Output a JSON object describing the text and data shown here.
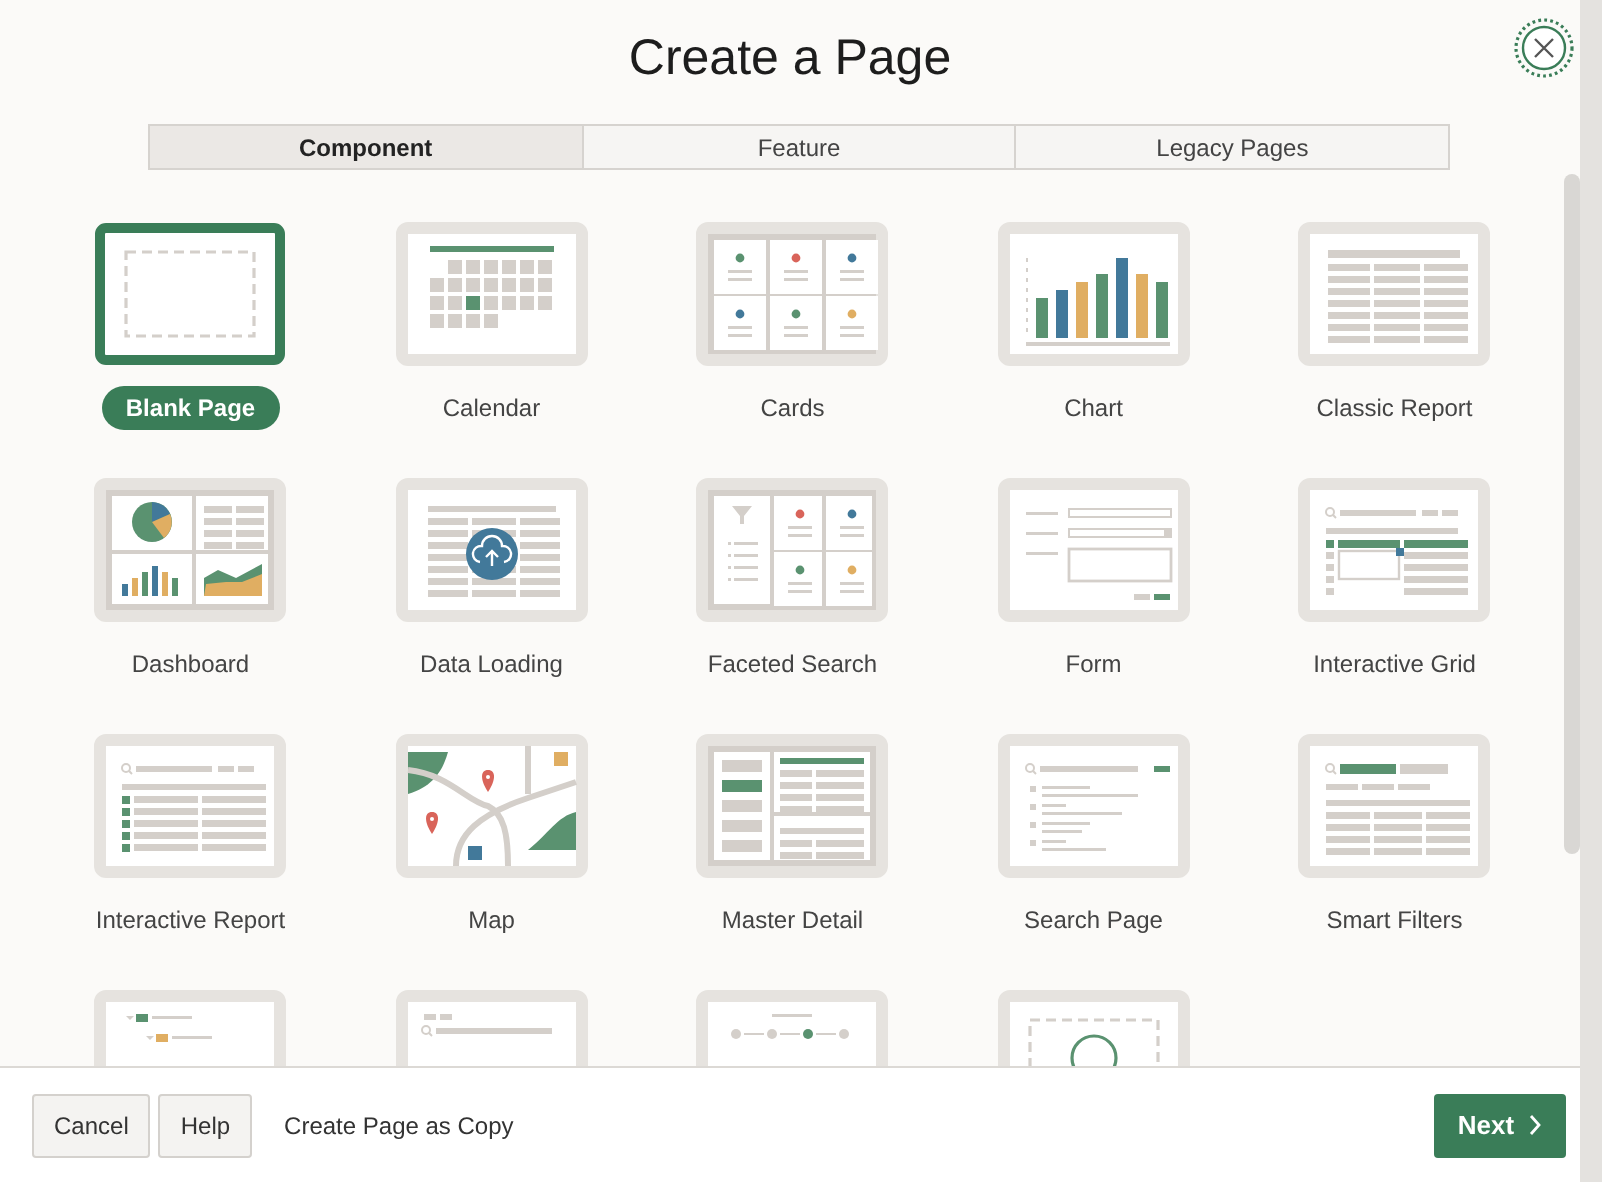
{
  "dialog": {
    "title": "Create a Page"
  },
  "tabs": [
    {
      "label": "Component",
      "selected": true
    },
    {
      "label": "Feature",
      "selected": false
    },
    {
      "label": "Legacy Pages",
      "selected": false
    }
  ],
  "templates": [
    {
      "kind": "blank",
      "label": "Blank Page",
      "selected": true
    },
    {
      "kind": "calendar",
      "label": "Calendar",
      "selected": false
    },
    {
      "kind": "cards",
      "label": "Cards",
      "selected": false
    },
    {
      "kind": "chart",
      "label": "Chart",
      "selected": false
    },
    {
      "kind": "classic_report",
      "label": "Classic Report",
      "selected": false
    },
    {
      "kind": "dashboard",
      "label": "Dashboard",
      "selected": false
    },
    {
      "kind": "data_loading",
      "label": "Data Loading",
      "selected": false
    },
    {
      "kind": "faceted_search",
      "label": "Faceted Search",
      "selected": false
    },
    {
      "kind": "form",
      "label": "Form",
      "selected": false
    },
    {
      "kind": "interactive_grid",
      "label": "Interactive Grid",
      "selected": false
    },
    {
      "kind": "interactive_report",
      "label": "Interactive Report",
      "selected": false
    },
    {
      "kind": "map",
      "label": "Map",
      "selected": false
    },
    {
      "kind": "master_detail",
      "label": "Master Detail",
      "selected": false
    },
    {
      "kind": "search_page",
      "label": "Search Page",
      "selected": false
    },
    {
      "kind": "smart_filters",
      "label": "Smart Filters",
      "selected": false
    },
    {
      "kind": "tree",
      "selected": false
    },
    {
      "kind": "list",
      "selected": false
    },
    {
      "kind": "wizard",
      "selected": false
    },
    {
      "kind": "circle",
      "selected": false
    }
  ],
  "footer": {
    "buttons": [
      "Cancel",
      "Help"
    ],
    "link": "Create Page as Copy",
    "next": "Next"
  }
}
